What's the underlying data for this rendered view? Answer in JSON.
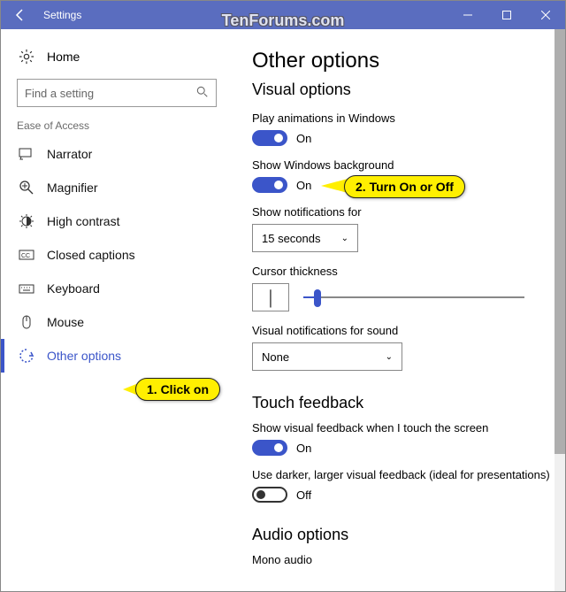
{
  "window": {
    "title": "Settings"
  },
  "watermark": "TenForums.com",
  "sidebar": {
    "home": "Home",
    "search_placeholder": "Find a setting",
    "group": "Ease of Access",
    "items": [
      {
        "label": "Narrator"
      },
      {
        "label": "Magnifier"
      },
      {
        "label": "High contrast"
      },
      {
        "label": "Closed captions"
      },
      {
        "label": "Keyboard"
      },
      {
        "label": "Mouse"
      },
      {
        "label": "Other options"
      }
    ]
  },
  "page": {
    "title": "Other options",
    "sections": {
      "visual": "Visual options",
      "touch": "Touch feedback",
      "audio": "Audio options"
    },
    "play_animations": {
      "label": "Play animations in Windows",
      "state": "On"
    },
    "show_background": {
      "label": "Show Windows background",
      "state": "On"
    },
    "notifications": {
      "label": "Show notifications for",
      "value": "15 seconds"
    },
    "cursor": {
      "label": "Cursor thickness"
    },
    "visual_notif": {
      "label": "Visual notifications for sound",
      "value": "None"
    },
    "touch_feedback": {
      "label": "Show visual feedback when I touch the screen",
      "state": "On"
    },
    "darker": {
      "label": "Use darker, larger visual feedback (ideal for presentations)",
      "state": "Off"
    },
    "mono": "Mono audio"
  },
  "callouts": {
    "c1": "1. Click on",
    "c2": "2. Turn On or Off"
  }
}
